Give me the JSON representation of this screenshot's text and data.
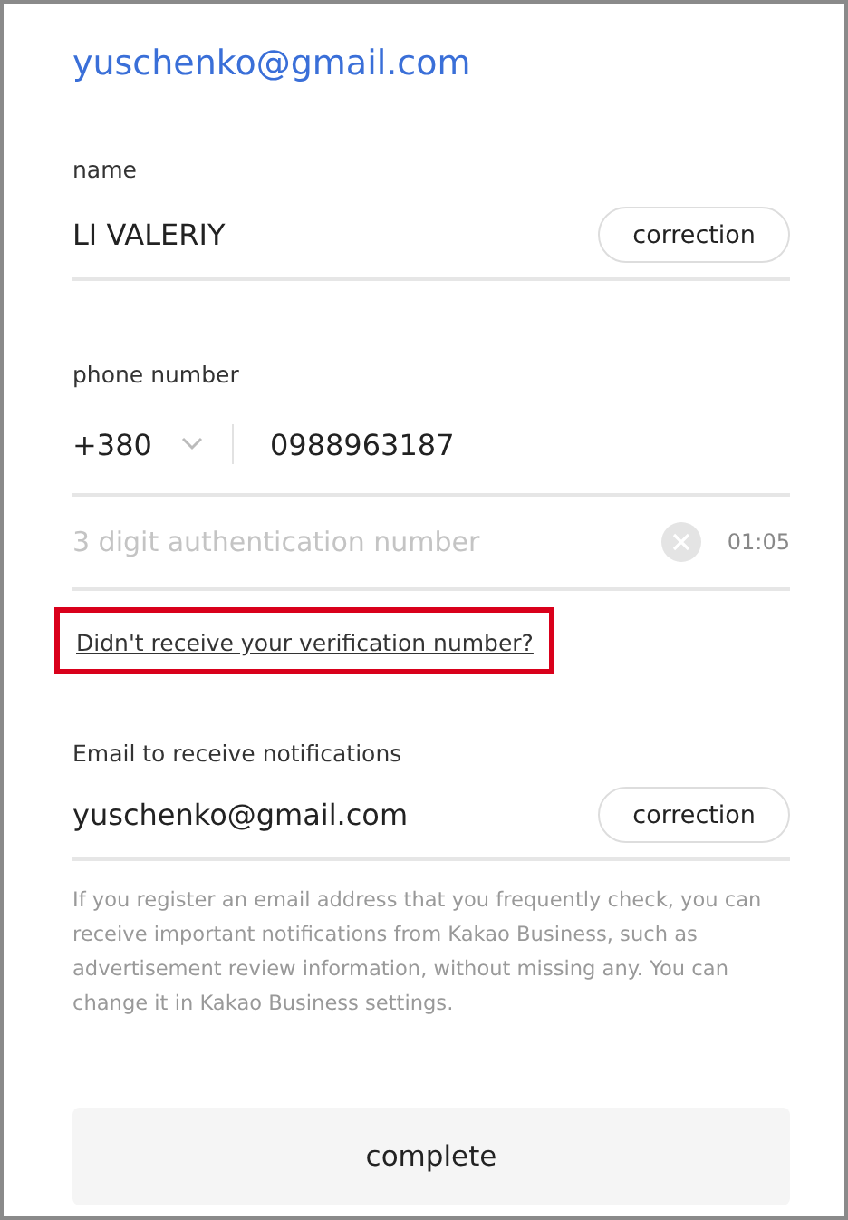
{
  "account_email": "yuschenko@gmail.com",
  "name_field": {
    "label": "name",
    "value": "LI VALERIY",
    "button": "correction"
  },
  "phone_field": {
    "label": "phone number",
    "country_code": "+380",
    "value": "0988963187"
  },
  "auth_field": {
    "placeholder": "3 digit authentication number",
    "timer": "01:05"
  },
  "resend_link": {
    "text": "Didn't receive your verification number?",
    "highlighted": true
  },
  "notify_email_field": {
    "label": "Email to receive notifications",
    "value": "yuschenko@gmail.com",
    "button": "correction"
  },
  "notify_help": "If you register an email address that you frequently check, you can receive important notifications from Kakao Business, such as advertisement review information, without missing any. You can change it in Kakao Business settings.",
  "complete_button": "complete"
}
